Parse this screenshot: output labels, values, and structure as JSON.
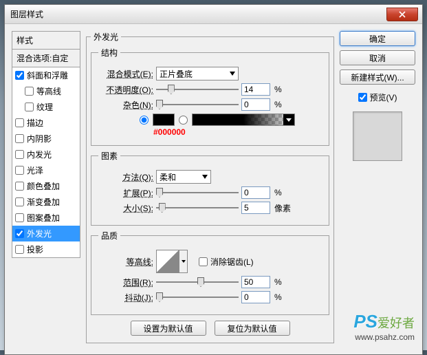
{
  "title": "图层样式",
  "left": {
    "header": "样式",
    "blend_opts": "混合选项:自定",
    "items": [
      {
        "label": "斜面和浮雕",
        "checked": true,
        "indent": false
      },
      {
        "label": "等高线",
        "checked": false,
        "indent": true
      },
      {
        "label": "纹理",
        "checked": false,
        "indent": true
      },
      {
        "label": "描边",
        "checked": false,
        "indent": false
      },
      {
        "label": "内阴影",
        "checked": false,
        "indent": false
      },
      {
        "label": "内发光",
        "checked": false,
        "indent": false
      },
      {
        "label": "光泽",
        "checked": false,
        "indent": false
      },
      {
        "label": "颜色叠加",
        "checked": false,
        "indent": false
      },
      {
        "label": "渐变叠加",
        "checked": false,
        "indent": false
      },
      {
        "label": "图案叠加",
        "checked": false,
        "indent": false
      },
      {
        "label": "外发光",
        "checked": true,
        "indent": false,
        "selected": true
      },
      {
        "label": "投影",
        "checked": false,
        "indent": false
      }
    ]
  },
  "main": {
    "group_title": "外发光",
    "structure": {
      "legend": "结构",
      "blend_mode_label": "混合模式(E):",
      "blend_mode_value": "正片叠底",
      "opacity_label": "不透明度(O):",
      "opacity_value": "14",
      "opacity_unit": "%",
      "noise_label": "杂色(N):",
      "noise_value": "0",
      "noise_unit": "%",
      "color_annotation": "#000000"
    },
    "elements": {
      "legend": "图素",
      "technique_label": "方法(Q):",
      "technique_value": "柔和",
      "spread_label": "扩展(P):",
      "spread_value": "0",
      "spread_unit": "%",
      "size_label": "大小(S):",
      "size_value": "5",
      "size_unit": "像素"
    },
    "quality": {
      "legend": "品质",
      "contour_label": "等高线:",
      "antialias_label": "消除锯齿(L)",
      "range_label": "范围(R):",
      "range_value": "50",
      "range_unit": "%",
      "jitter_label": "抖动(J):",
      "jitter_value": "0",
      "jitter_unit": "%"
    },
    "defaults": {
      "set_default": "设置为默认值",
      "reset_default": "复位为默认值"
    }
  },
  "right": {
    "ok": "确定",
    "cancel": "取消",
    "new_style": "新建样式(W)...",
    "preview_label": "预览(V)"
  },
  "watermark": {
    "ps": "PS",
    "zh": "爱好者",
    "url": "www.psahz.com"
  }
}
